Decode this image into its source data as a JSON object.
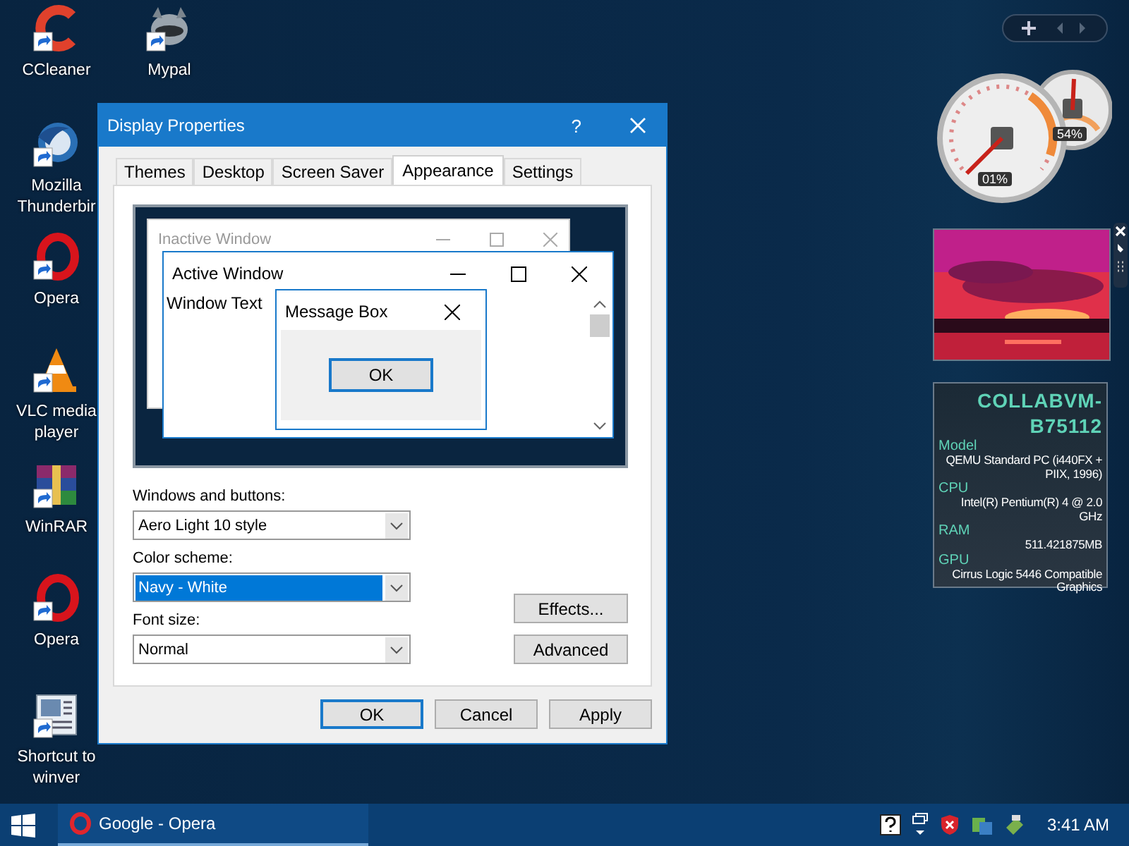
{
  "desktop_icons": [
    {
      "label": "CCleaner",
      "kind": "arc"
    },
    {
      "label": "Mypal",
      "kind": "animal"
    },
    {
      "label": "Mozilla Thunderbir",
      "kind": "globe"
    },
    {
      "label": "Opera",
      "kind": "ring"
    },
    {
      "label": "VLC media player",
      "kind": "cone"
    },
    {
      "label": "WinRAR",
      "kind": "stack"
    },
    {
      "label": "Opera",
      "kind": "ring"
    },
    {
      "label": "Shortcut to winver",
      "kind": "document"
    }
  ],
  "dialog": {
    "title": "Display Properties",
    "help": "?",
    "tabs": [
      {
        "label": "Themes",
        "selected": false
      },
      {
        "label": "Desktop",
        "selected": false
      },
      {
        "label": "Screen Saver",
        "selected": false
      },
      {
        "label": "Appearance",
        "selected": true
      },
      {
        "label": "Settings",
        "selected": false
      }
    ],
    "preview": {
      "inactive_title": "Inactive Window",
      "active_title": "Active Window",
      "window_text": "Window Text",
      "message_title": "Message Box",
      "message_button": "OK"
    },
    "fields": [
      {
        "label": "Windows and buttons:",
        "value": "Aero Light 10 style",
        "highlighted": false
      },
      {
        "label": "Color scheme:",
        "value": "Navy - White",
        "highlighted": true
      },
      {
        "label": "Font size:",
        "value": "Normal",
        "highlighted": false
      }
    ],
    "side_buttons": [
      "Effects...",
      "Advanced"
    ],
    "footer_buttons": [
      {
        "label": "OK",
        "default": true
      },
      {
        "label": "Cancel",
        "default": false
      },
      {
        "label": "Apply",
        "default": false
      }
    ]
  },
  "gadgets": {
    "meter": {
      "cpu": {
        "reading": "01%"
      },
      "ram": {
        "reading": "54%"
      }
    },
    "system_info": {
      "name": "COLLABVM-B75112",
      "rows": [
        {
          "label": "Model",
          "value": "QEMU Standard PC (i440FX + PIIX, 1996)"
        },
        {
          "label": "CPU",
          "value": "Intel(R) Pentium(R) 4 @ 2.0 GHz"
        },
        {
          "label": "RAM",
          "value": "511.421875MB"
        },
        {
          "label": "GPU",
          "value": "Cirrus Logic 5446 Compatible Graphics"
        }
      ]
    }
  },
  "taskbar": {
    "tasks": [
      {
        "label": "Google - Opera",
        "active": true
      }
    ],
    "clock": "3:41 AM"
  }
}
